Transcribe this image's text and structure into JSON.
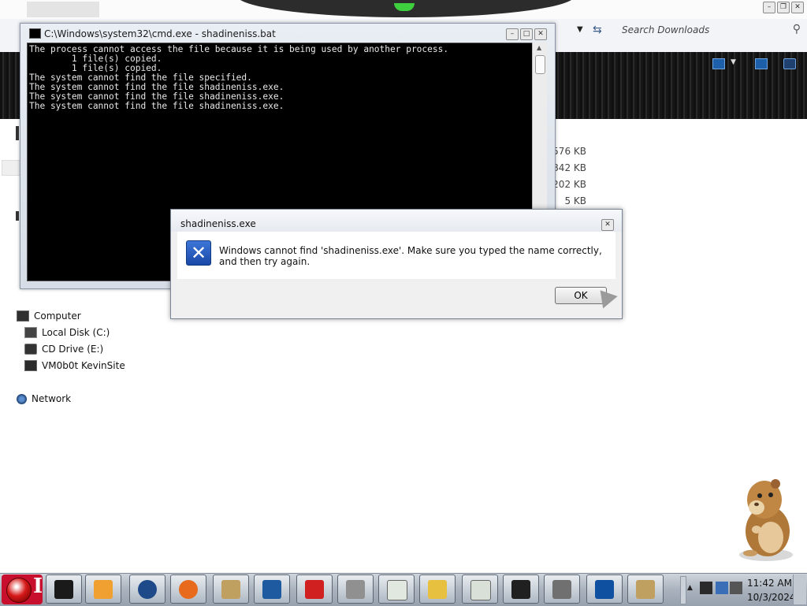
{
  "explorer": {
    "search": {
      "placeholder": "Search Downloads"
    },
    "file_sizes": [
      "576 KB",
      ",842 KB",
      "202 KB",
      "5 KB"
    ],
    "tree": {
      "computer": "Computer",
      "local_disk": "Local Disk (C:)",
      "cd_drive": "CD Drive (E:)",
      "net_drive": "VM0b0t KevinSite",
      "network": "Network"
    }
  },
  "cmd": {
    "title": "C:\\Windows\\system32\\cmd.exe - shadineniss.bat",
    "output": "The process cannot access the file because it is being used by another process.\n        1 file(s) copied.\n        1 file(s) copied.\nThe system cannot find the file specified.\nThe system cannot find the file shadineniss.exe.\nThe system cannot find the file shadineniss.exe.\nThe system cannot find the file shadineniss.exe."
  },
  "dialog": {
    "title": "shadineniss.exe",
    "message": "Windows cannot find 'shadineniss.exe'. Make sure you typed the name correctly, and then try again.",
    "ok_label": "OK",
    "error_icon_glyph": "✕"
  },
  "taskbar": {
    "start_letter": "I",
    "clock_time": "11:42 AM",
    "clock_date": "10/3/2024",
    "buttons": [
      {
        "name": "black-box-app-icon",
        "color": "#1a1a1a"
      },
      {
        "name": "media-player-icon",
        "color": "#f0a030"
      },
      {
        "name": "globe-icon",
        "color": "#1e4a8a"
      },
      {
        "name": "firefox-icon",
        "color": "#e86a1c"
      },
      {
        "name": "hamster-box-icon",
        "color": "#c0a060"
      },
      {
        "name": "monitor-icon",
        "color": "#1e5aa0"
      },
      {
        "name": "shapes-icon",
        "color": "#d02020"
      },
      {
        "name": "printer-icon",
        "color": "#909090"
      },
      {
        "name": "document-viewer-icon",
        "color": "#e0e8e0"
      },
      {
        "name": "calculator-icon",
        "color": "#e8c040"
      },
      {
        "name": "card-viewer-icon",
        "color": "#d8e0d8"
      },
      {
        "name": "dark-window-icon",
        "color": "#202020"
      },
      {
        "name": "settings-window-icon",
        "color": "#707070"
      },
      {
        "name": "phone-icon",
        "color": "#1050a0"
      },
      {
        "name": "hamster-box-icon-2",
        "color": "#c0a060"
      }
    ]
  }
}
